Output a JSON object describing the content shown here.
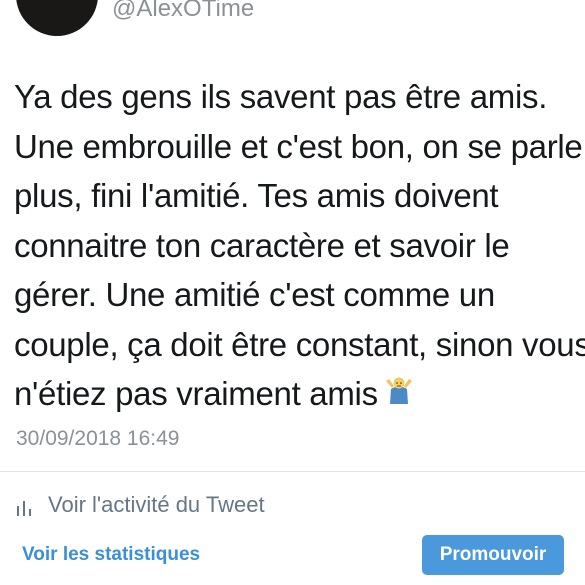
{
  "tweet": {
    "handle": "@AlexOTime",
    "text_lines": [
      "Ya des gens ils savent pas être amis.",
      "Une embrouille et c'est bon, on se parle",
      "plus, fini l'amitié. Tes amis doivent",
      "connaitre ton caractère et savoir le",
      "gérer. Une amitié c'est comme un",
      "couple, ça doit être constant, sinon vous",
      "n'étiez pas vraiment amis"
    ],
    "emoji": "person-shrugging-emoji",
    "timestamp": "30/09/2018 16:49"
  },
  "activity": {
    "icon": "bar-chart-icon",
    "label": "Voir l'activité du Tweet"
  },
  "footer": {
    "stats_link": "Voir les statistiques",
    "promote_button": "Promouvoir"
  },
  "colors": {
    "text": "#16191c",
    "muted": "#8a9197",
    "link": "#3b8fd8",
    "button": "#4a99dc"
  }
}
